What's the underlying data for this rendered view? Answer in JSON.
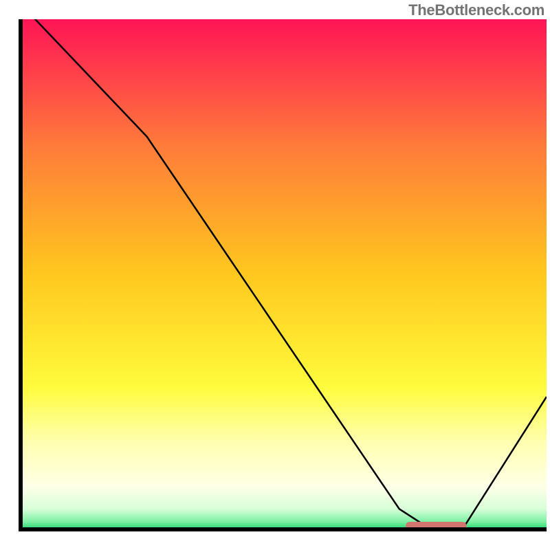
{
  "watermark": "TheBottleneck.com",
  "chart_data": {
    "type": "line",
    "title": "",
    "xlabel": "",
    "ylabel": "",
    "xlim": [
      0,
      100
    ],
    "ylim": [
      0,
      100
    ],
    "grid": false,
    "curve": {
      "x": [
        0,
        24,
        72,
        78,
        84,
        100
      ],
      "y": [
        103,
        77,
        4,
        0,
        0,
        26
      ]
    },
    "marker_segment": {
      "x": [
        74,
        84
      ],
      "y": [
        0,
        0
      ]
    },
    "gradient_stops": [
      {
        "offset": 0.0,
        "color": "#ff1456"
      },
      {
        "offset": 0.25,
        "color": "#ff7c3a"
      },
      {
        "offset": 0.5,
        "color": "#ffc81e"
      },
      {
        "offset": 0.72,
        "color": "#fffb3c"
      },
      {
        "offset": 0.83,
        "color": "#ffffb1"
      },
      {
        "offset": 0.915,
        "color": "#ffffe7"
      },
      {
        "offset": 0.96,
        "color": "#d8ffd8"
      },
      {
        "offset": 0.985,
        "color": "#7df0a4"
      },
      {
        "offset": 1.0,
        "color": "#21d66d"
      }
    ],
    "colors": {
      "axis": "#000000",
      "curve": "#000000",
      "marker": "#d1766f"
    }
  }
}
